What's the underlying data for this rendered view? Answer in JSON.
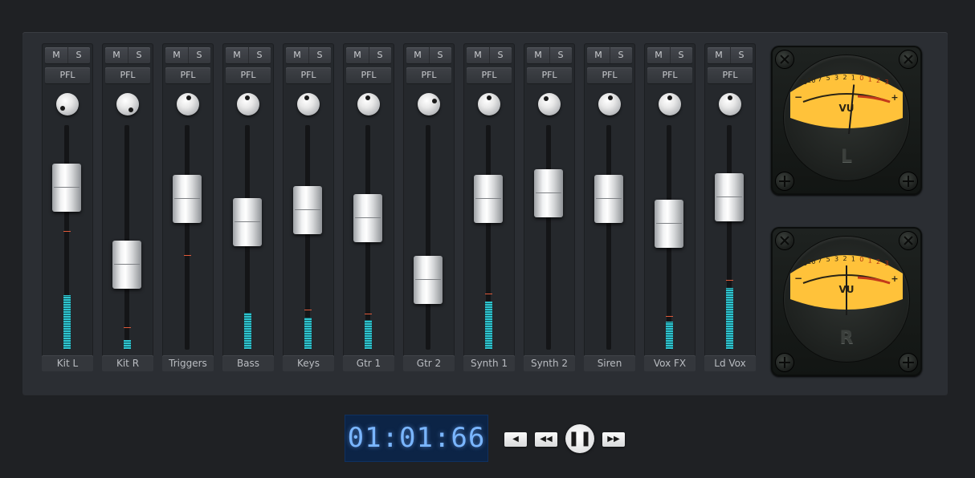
{
  "channels": [
    {
      "name": "Kit L",
      "mute": "M",
      "solo": "S",
      "pfl": "PFL",
      "fader_level": 0.76,
      "meter_level": 0.24,
      "peak_level": 0.53,
      "pan_deg": -130
    },
    {
      "name": "Kit R",
      "mute": "M",
      "solo": "S",
      "pfl": "PFL",
      "fader_level": 0.36,
      "meter_level": 0.04,
      "peak_level": 0.1,
      "pan_deg": 150
    },
    {
      "name": "Triggers",
      "mute": "M",
      "solo": "S",
      "pfl": "PFL",
      "fader_level": 0.7,
      "meter_level": 0.0,
      "peak_level": 0.42,
      "pan_deg": 10
    },
    {
      "name": "Bass",
      "mute": "M",
      "solo": "S",
      "pfl": "PFL",
      "fader_level": 0.58,
      "meter_level": 0.16,
      "peak_level": 0.0,
      "pan_deg": -5
    },
    {
      "name": "Keys",
      "mute": "M",
      "solo": "S",
      "pfl": "PFL",
      "fader_level": 0.64,
      "meter_level": 0.14,
      "peak_level": 0.18,
      "pan_deg": -15
    },
    {
      "name": "Gtr 1",
      "mute": "M",
      "solo": "S",
      "pfl": "PFL",
      "fader_level": 0.6,
      "meter_level": 0.13,
      "peak_level": 0.16,
      "pan_deg": -10
    },
    {
      "name": "Gtr 2",
      "mute": "M",
      "solo": "S",
      "pfl": "PFL",
      "fader_level": 0.28,
      "meter_level": 0.0,
      "peak_level": 0.0,
      "pan_deg": 60
    },
    {
      "name": "Synth 1",
      "mute": "M",
      "solo": "S",
      "pfl": "PFL",
      "fader_level": 0.7,
      "meter_level": 0.21,
      "peak_level": 0.25,
      "pan_deg": 0
    },
    {
      "name": "Synth 2",
      "mute": "M",
      "solo": "S",
      "pfl": "PFL",
      "fader_level": 0.73,
      "meter_level": 0.0,
      "peak_level": 0.0,
      "pan_deg": -30
    },
    {
      "name": "Siren",
      "mute": "M",
      "solo": "S",
      "pfl": "PFL",
      "fader_level": 0.7,
      "meter_level": 0.0,
      "peak_level": 0.0,
      "pan_deg": 10
    },
    {
      "name": "Vox FX",
      "mute": "M",
      "solo": "S",
      "pfl": "PFL",
      "fader_level": 0.57,
      "meter_level": 0.12,
      "peak_level": 0.15,
      "pan_deg": 0
    },
    {
      "name": "Ld Vox",
      "mute": "M",
      "solo": "S",
      "pfl": "PFL",
      "fader_level": 0.71,
      "meter_level": 0.27,
      "peak_level": 0.31,
      "pan_deg": 0
    }
  ],
  "vu_meters": [
    {
      "channel": "L",
      "label": "VU",
      "scale": [
        "20",
        "10",
        "7",
        "5",
        "3",
        "2",
        "1",
        "0",
        "1",
        "2",
        "3"
      ],
      "minus": "−",
      "plus": "+",
      "needle_level": 0.56
    },
    {
      "channel": "R",
      "label": "VU",
      "scale": [
        "20",
        "10",
        "7",
        "5",
        "3",
        "2",
        "1",
        "0",
        "1",
        "2",
        "3"
      ],
      "minus": "−",
      "plus": "+",
      "needle_level": 0.5
    }
  ],
  "transport": {
    "timecode": "01:01:66",
    "back_icon": "◀",
    "rewind_icon": "◀◀",
    "pause_icon": "❚❚",
    "forward_icon": "▶▶"
  },
  "colors": {
    "meter": "#2ec4cf",
    "peak": "#e05a3a",
    "vu_face": "#ffc23a",
    "timecode": "#7ab6ff"
  }
}
